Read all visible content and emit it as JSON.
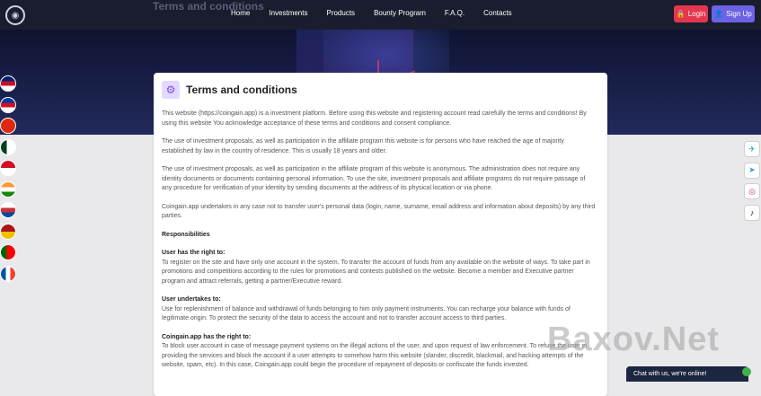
{
  "header": {
    "page_title": "Terms and conditions",
    "nav": [
      "Home",
      "Investments",
      "Products",
      "Bounty Program",
      "F.A.Q.",
      "Contacts"
    ],
    "login_label": "Login",
    "signup_label": "Sign Up"
  },
  "languages": [
    {
      "name": "uk-flag-icon",
      "colors": [
        "#012169",
        "#c8102e",
        "#ffffff"
      ]
    },
    {
      "name": "philippines-flag-icon",
      "colors": [
        "#0038a8",
        "#ce1126",
        "#ffffff"
      ]
    },
    {
      "name": "china-flag-icon",
      "colors": [
        "#de2910",
        "#ffde00"
      ]
    },
    {
      "name": "pakistan-flag-icon",
      "colors": [
        "#01411c",
        "#ffffff"
      ]
    },
    {
      "name": "indonesia-flag-icon",
      "colors": [
        "#ce1126",
        "#ffffff"
      ]
    },
    {
      "name": "india-flag-icon",
      "colors": [
        "#ff9933",
        "#ffffff",
        "#138808"
      ]
    },
    {
      "name": "korea-flag-icon",
      "colors": [
        "#ffffff",
        "#cd2e3a",
        "#0047a0"
      ]
    },
    {
      "name": "spain-flag-icon",
      "colors": [
        "#aa151b",
        "#f1bf00"
      ]
    },
    {
      "name": "portugal-flag-icon",
      "colors": [
        "#006600",
        "#ff0000"
      ]
    },
    {
      "name": "france-flag-icon",
      "colors": [
        "#0055a4",
        "#ffffff",
        "#ef4135"
      ]
    }
  ],
  "social": [
    {
      "name": "messenger-icon",
      "glyph": "✈",
      "color": "#2aa3e0"
    },
    {
      "name": "telegram-icon",
      "glyph": "➤",
      "color": "#2aa3e0"
    },
    {
      "name": "instagram-icon",
      "glyph": "◎",
      "color": "#c13584"
    },
    {
      "name": "tiktok-icon",
      "glyph": "♪",
      "color": "#000000"
    }
  ],
  "card": {
    "title": "Terms and conditions",
    "p1": "This website (https://coingain.app) is a investment platform. Before using this website and registering account read carefully the terms and conditions! By using this website You acknowledge acceptance of these terms and conditions and consent compliance.",
    "p2": "The use of investment proposals, as well as participation in the affiliate program this website is for persons who have reached the age of majority established by law in the country of residence. This is usually 18 years and older.",
    "p3": "The use of investment proposals, as well as participation in the affiliate program of this website is anonymous. The administration does not require any identity documents or documents containing personal information. To use the site, investment proposals and affiliate programs do not require passage of any procedure for verification of your identity by sending documents at the address of its physical location or via phone.",
    "p4": "Coingain.app undertakes in any case not to transfer user's personal data (login, name, surname, email address and information about deposits) by any third parties.",
    "h_responsibilities": "Responsibilities",
    "h_user_right": "User has the right to:",
    "p5": "To register on the site and have only one account in the system. To transfer the account of funds from any available on the website of ways. To take part in promotions and competitions according to the rules for promotions and contests published on the website. Become a member and Executive partner program and attract referrals, getting a partner/Executive reward.",
    "h_user_undertakes": "User undertakes to:",
    "p6": "Use for replenishment of balance and withdrawal of funds belonging to him only payment instruments. You can recharge your balance with funds of legitimate origin. To protect the security of the data to access the account and not to transfer account access to third parties.",
    "h_coingain_right": "Coingain.app has the right to:",
    "p7": "To block user account in case of message payment systems on the illegal actions of the user, and upon request of law enforcement. To refuse the user in providing the services and block the account if a user attempts to somehow harm this website (slander, discredit, blackmail, and hacking attempts of the website, spam, etc). In this case, Coingain.app could begin the procedure of repayment of deposits or confiscate the funds invested."
  },
  "watermark": "Baxov.Net",
  "chat_label": "Chat with us, we're online!"
}
